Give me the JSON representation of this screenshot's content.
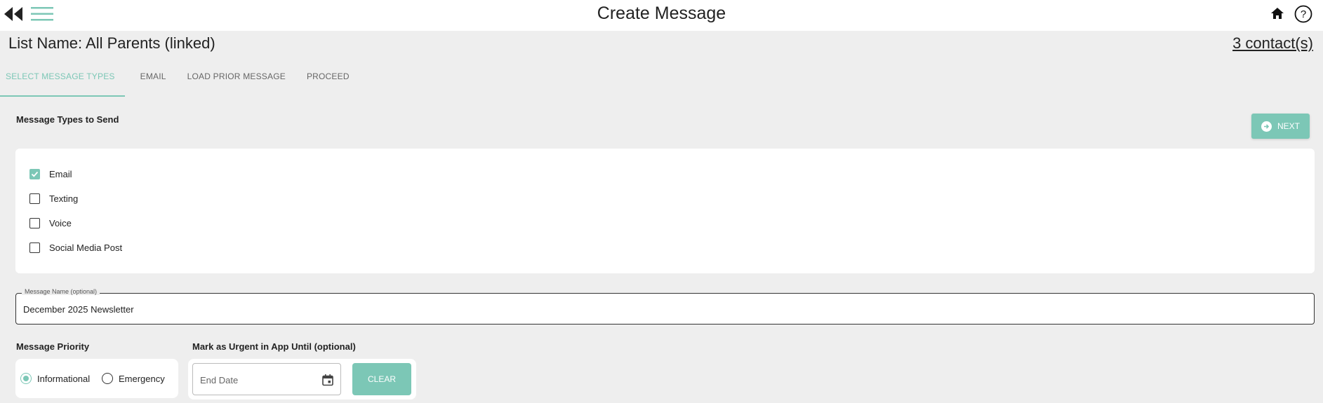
{
  "app": {
    "title": "Create Message"
  },
  "header": {
    "list_name": "List Name: All Parents (linked)",
    "contacts_link": "3 contact(s)"
  },
  "tabs": [
    {
      "label": "SELECT MESSAGE TYPES",
      "active": true
    },
    {
      "label": "EMAIL",
      "active": false
    },
    {
      "label": "LOAD PRIOR MESSAGE",
      "active": false
    },
    {
      "label": "PROCEED",
      "active": false
    }
  ],
  "message_types": {
    "heading": "Message Types to Send",
    "next_label": "NEXT",
    "options": [
      {
        "label": "Email",
        "checked": true
      },
      {
        "label": "Texting",
        "checked": false
      },
      {
        "label": "Voice",
        "checked": false
      },
      {
        "label": "Social Media Post",
        "checked": false
      }
    ]
  },
  "message_name": {
    "label": "Message Name (optional)",
    "value": "December 2025 Newsletter"
  },
  "priority": {
    "heading": "Message Priority",
    "options": [
      {
        "label": "Informational",
        "selected": true
      },
      {
        "label": "Emergency",
        "selected": false
      }
    ]
  },
  "urgent": {
    "heading": "Mark as Urgent in App Until (optional)",
    "end_date_placeholder": "End Date",
    "end_date_value": "",
    "clear_label": "CLEAR"
  },
  "colors": {
    "accent": "#7cc7b6",
    "background": "#eeeeee",
    "surface": "#ffffff"
  },
  "icons": {
    "back": "double-chevron-left-icon",
    "menu": "hamburger-menu-icon",
    "home": "home-icon",
    "help": "help-circle-icon",
    "next": "arrow-right-circle-icon",
    "calendar": "calendar-icon"
  }
}
